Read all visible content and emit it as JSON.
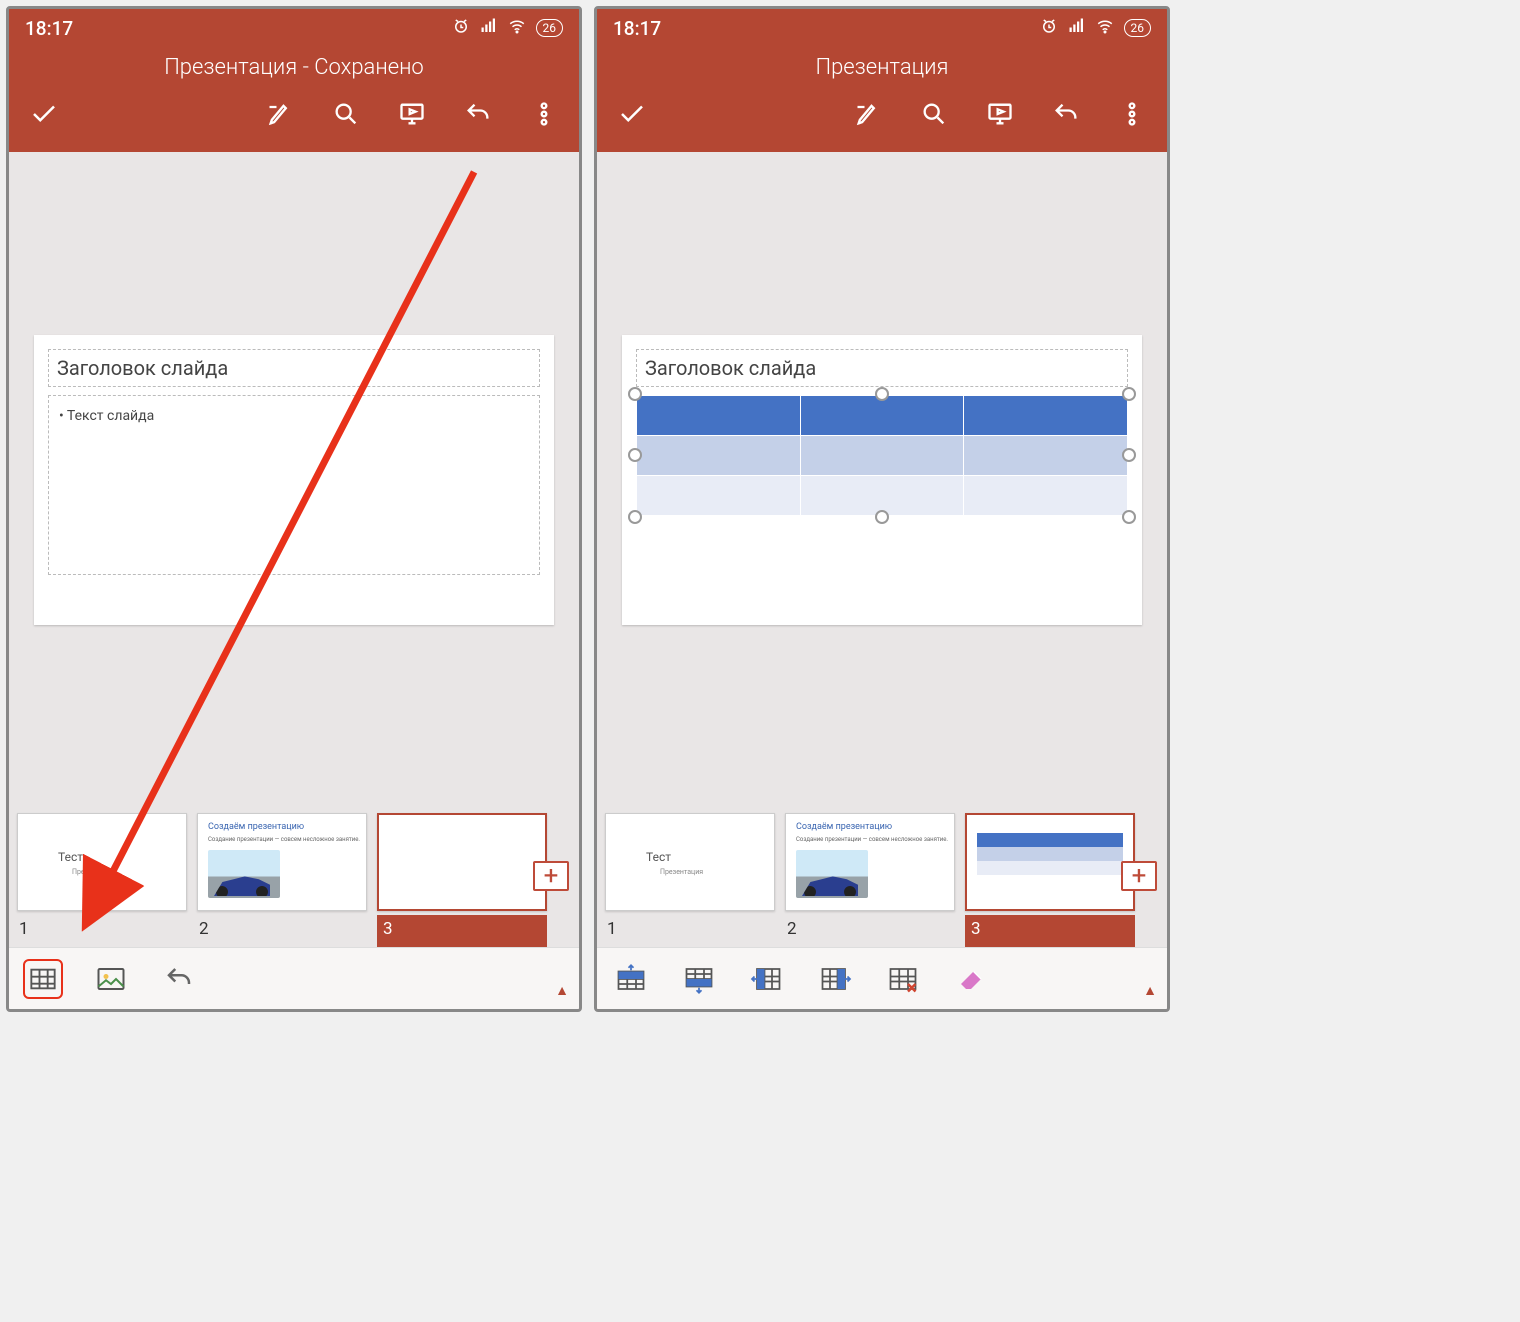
{
  "status": {
    "time": "18:17",
    "battery": "26"
  },
  "left": {
    "title": "Презентация - Сохранено",
    "slide_title": "Заголовок слайда",
    "slide_body": "• Текст слайда"
  },
  "right": {
    "title": "Презентация",
    "slide_title": "Заголовок слайда"
  },
  "thumbs": {
    "t1": {
      "num": "1",
      "title": "Тест",
      "sub": "Презентация"
    },
    "t2": {
      "num": "2",
      "title": "Создаём презентацию",
      "sub": "Создание презентации — совсем несложное занятие."
    },
    "t3": {
      "num": "3"
    }
  }
}
